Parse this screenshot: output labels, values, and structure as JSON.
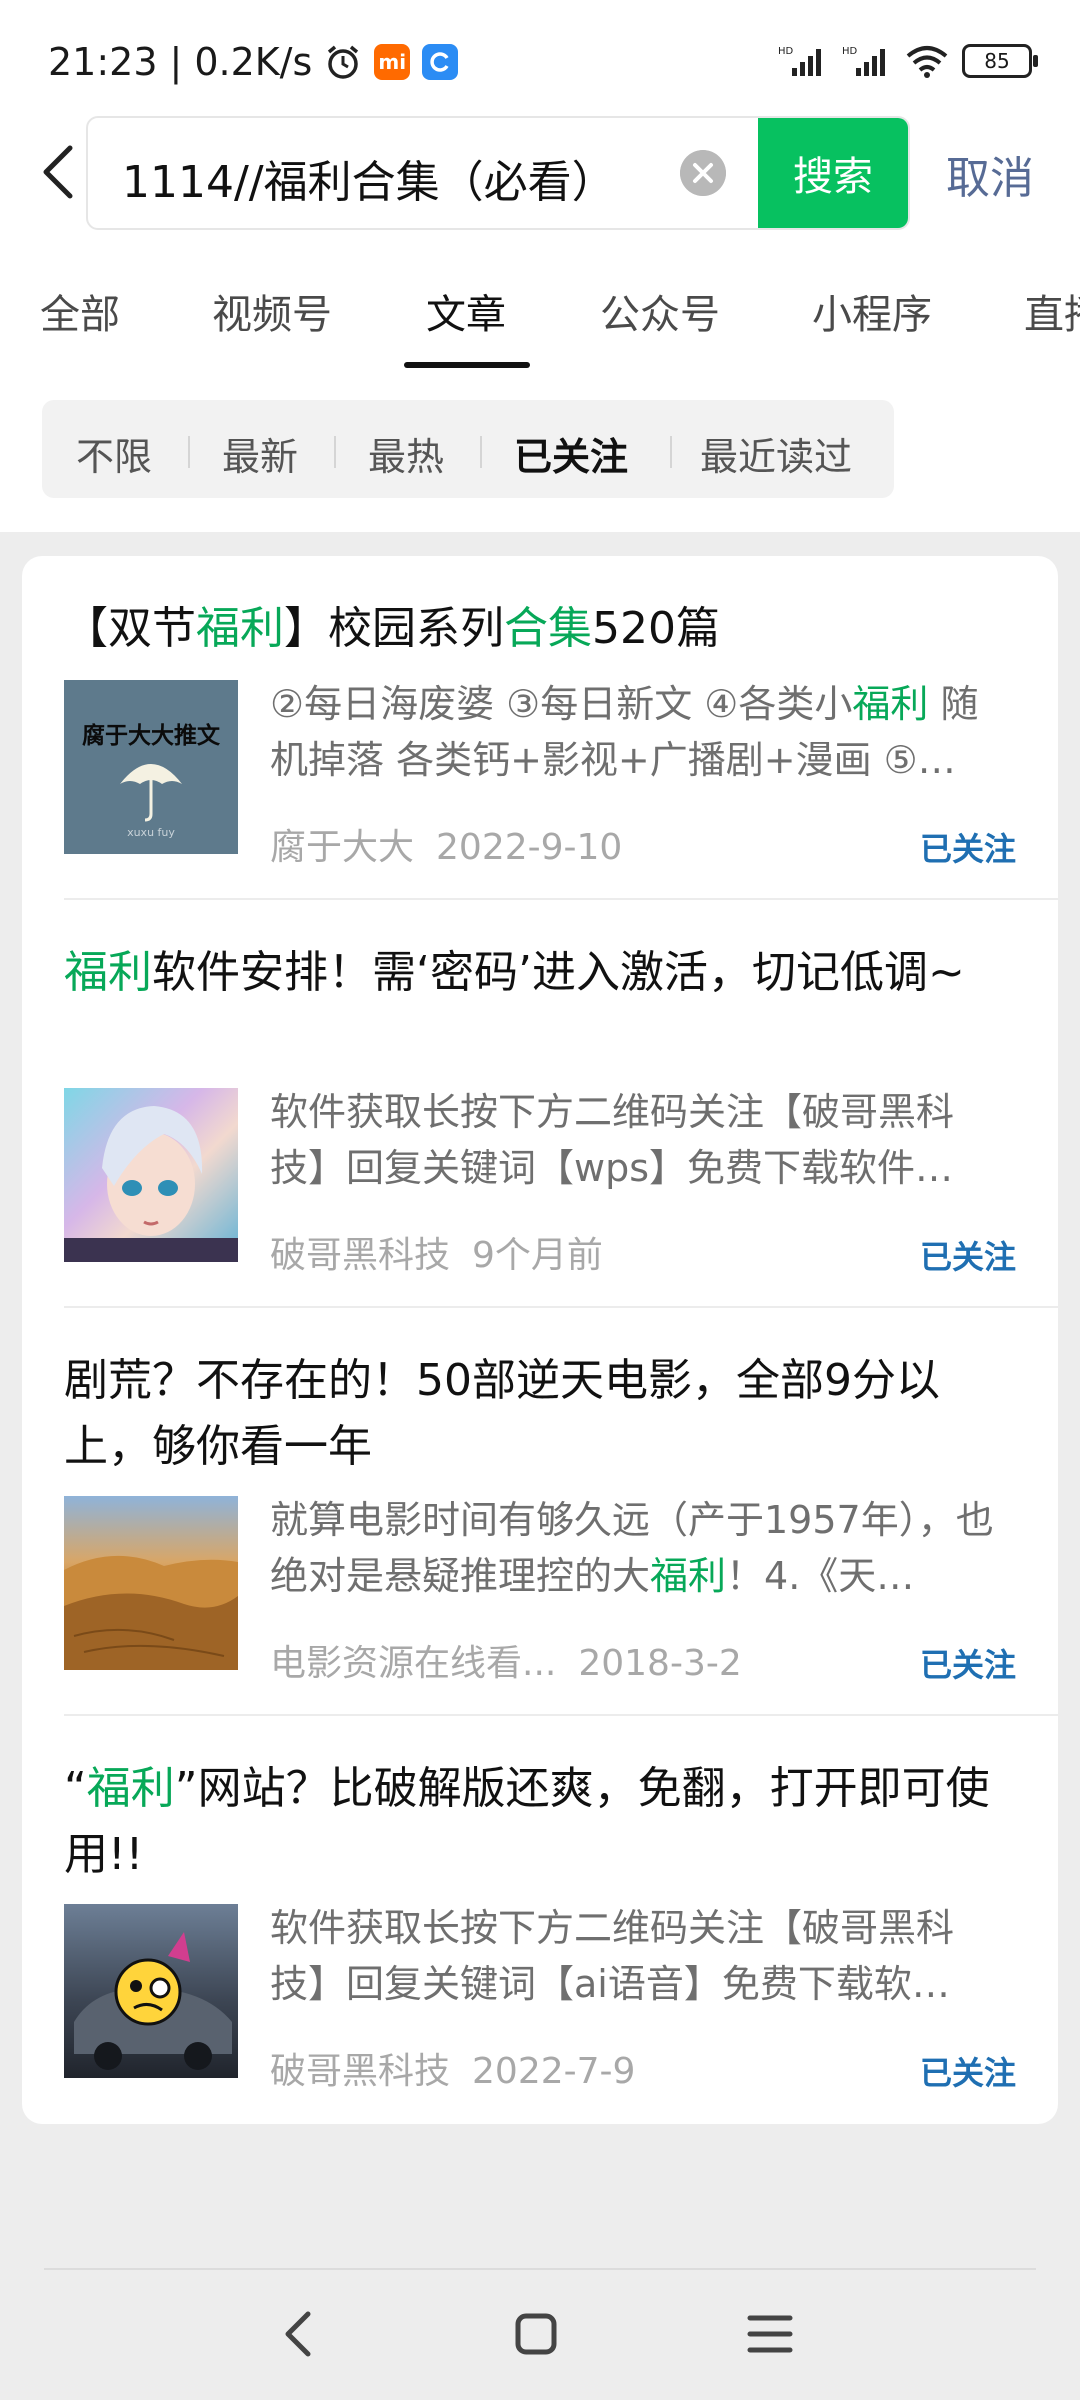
{
  "status_bar": {
    "time": "21:23",
    "speed": "0.2K/s",
    "battery": "85",
    "mi_badge": "mi"
  },
  "search": {
    "query": "1114//福利合集（必看）",
    "button_label": "搜索",
    "cancel_label": "取消"
  },
  "tabs": [
    {
      "label": "全部"
    },
    {
      "label": "视频号"
    },
    {
      "label": "文章",
      "active": true
    },
    {
      "label": "公众号"
    },
    {
      "label": "小程序"
    },
    {
      "label": "直播"
    }
  ],
  "filters": [
    {
      "label": "不限"
    },
    {
      "label": "最新"
    },
    {
      "label": "最热"
    },
    {
      "label": "已关注",
      "active": true
    },
    {
      "label": "最近读过"
    }
  ],
  "results": [
    {
      "title_parts": [
        "【双节",
        "福利",
        "】校园系列",
        "合集",
        "520篇"
      ],
      "snippet_parts": [
        "②每日海废婆 ③每日新文 ④各类小",
        "福利",
        " 随机掉落 各类钙+影视+广播剧+漫画 ⑤…"
      ],
      "thumb_text": "腐于大大推文",
      "thumb_caption": "xuxu fuy",
      "source": "腐于大大",
      "date": "2022-9-10",
      "tag": "已关注"
    },
    {
      "title_parts": [
        "福利",
        "软件安排！需‘密码’进入激活，切记低调~"
      ],
      "snippet_parts": [
        "软件获取长按下方二维码关注【破哥黑科技】回复关键词【wps】免费下载软件…"
      ],
      "source": "破哥黑科技",
      "date": "9个月前",
      "tag": "已关注"
    },
    {
      "title_parts": [
        "剧荒？不存在的！50部逆天电影，全部9分以上，够你看一年"
      ],
      "snippet_parts": [
        "就算电影时间有够久远（产于1957年），也绝对是悬疑推理控的大",
        "福利",
        "！4.《天…"
      ],
      "source": "电影资源在线看...",
      "date": "2018-3-2",
      "tag": "已关注"
    },
    {
      "title_parts": [
        "“",
        "福利",
        "”网站？比破解版还爽，免翻，打开即可使用!!"
      ],
      "snippet_parts": [
        "软件获取长按下方二维码关注【破哥黑科技】回复关键词【ai语音】免费下载软…"
      ],
      "source": "破哥黑科技",
      "date": "2022-7-9",
      "tag": "已关注"
    }
  ],
  "colors": {
    "accent_green": "#07c160",
    "highlight_green": "#07a858",
    "follow_blue": "#1f6fb2",
    "link_blue": "#576b95"
  }
}
